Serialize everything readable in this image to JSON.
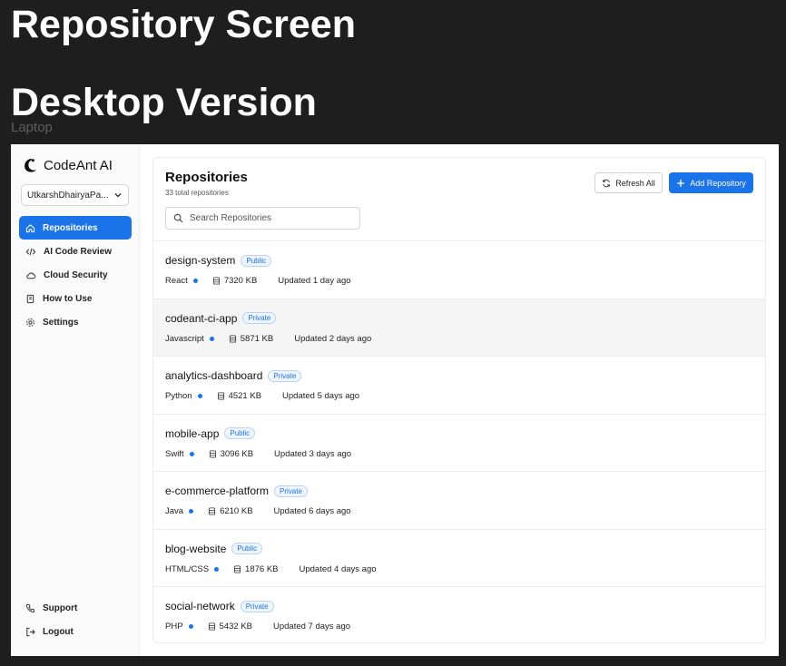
{
  "canvas": {
    "title": "Repository Screen",
    "section_title": "Desktop Version",
    "frame_label": "Laptop"
  },
  "sidebar": {
    "brand": "CodeAnt AI",
    "org_select": "UtkarshDhairyaPa...",
    "items": [
      {
        "label": "Repositories",
        "icon": "home-icon",
        "active": true
      },
      {
        "label": "AI Code Review",
        "icon": "code-icon",
        "active": false
      },
      {
        "label": "Cloud Security",
        "icon": "cloud-icon",
        "active": false
      },
      {
        "label": "How to Use",
        "icon": "book-icon",
        "active": false
      },
      {
        "label": "Settings",
        "icon": "gear-icon",
        "active": false
      }
    ],
    "bottom_items": [
      {
        "label": "Support",
        "icon": "phone-icon"
      },
      {
        "label": "Logout",
        "icon": "logout-icon"
      }
    ]
  },
  "main": {
    "title": "Repositories",
    "count_text": "33 total repositories",
    "search_placeholder": "Search Repositories",
    "refresh_label": "Refresh All",
    "add_label": "Add Repository",
    "repos": [
      {
        "name": "design-system",
        "visibility": "Public",
        "language": "React",
        "size": "7320 KB",
        "updated": "Updated 1 day ago"
      },
      {
        "name": "codeant-ci-app",
        "visibility": "Private",
        "language": "Javascript",
        "size": "5871 KB",
        "updated": "Updated 2 days ago"
      },
      {
        "name": "analytics-dashboard",
        "visibility": "Private",
        "language": "Python",
        "size": "4521 KB",
        "updated": "Updated 5 days ago"
      },
      {
        "name": "mobile-app",
        "visibility": "Public",
        "language": "Swift",
        "size": "3096 KB",
        "updated": "Updated 3 days ago"
      },
      {
        "name": "e-commerce-platform",
        "visibility": "Private",
        "language": "Java",
        "size": "6210 KB",
        "updated": "Updated 6 days ago"
      },
      {
        "name": "blog-website",
        "visibility": "Public",
        "language": "HTML/CSS",
        "size": "1876 KB",
        "updated": "Updated 4 days ago"
      },
      {
        "name": "social-network",
        "visibility": "Private",
        "language": "PHP",
        "size": "5432 KB",
        "updated": "Updated 7 days ago"
      }
    ]
  },
  "colors": {
    "accent": "#1a73e8",
    "background": "#1e1e1e"
  }
}
